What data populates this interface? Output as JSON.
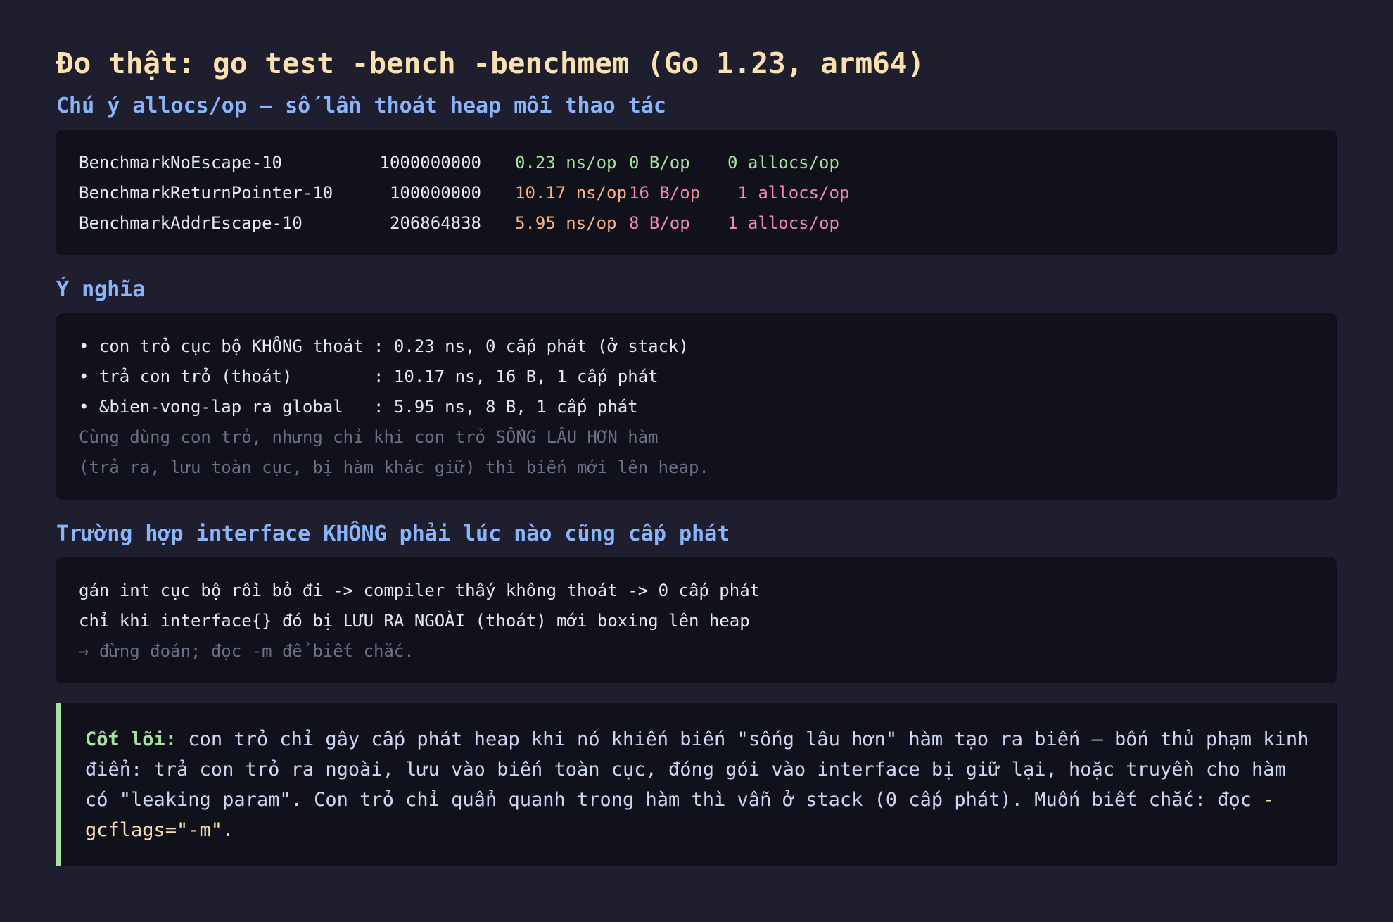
{
  "title": "Đo thật: go test -bench -benchmem (Go 1.23, arm64)",
  "section1": {
    "heading": "Chú ý allocs/op — số lần thoát heap mỗi thao tác",
    "rows": [
      {
        "name": "BenchmarkNoEscape-10",
        "iterations": "1000000000",
        "ns": "0.23 ns/op",
        "bytes": "0 B/op",
        "allocs": "0 allocs/op"
      },
      {
        "name": "BenchmarkReturnPointer-10",
        "iterations": "100000000",
        "ns": "10.17 ns/op",
        "bytes": "16 B/op",
        "allocs": " 1 allocs/op"
      },
      {
        "name": "BenchmarkAddrEscape-10",
        "iterations": "206864838",
        "ns": "5.95 ns/op",
        "bytes": "8 B/op",
        "allocs": "1 allocs/op"
      }
    ]
  },
  "section2": {
    "heading": "Ý nghĩa",
    "lines": [
      "• con trỏ cục bộ KHÔNG thoát : 0.23 ns, 0 cấp phát (ở stack)",
      "• trả con trỏ (thoát)        : 10.17 ns, 16 B, 1 cấp phát",
      "• &bien-vong-lap ra global   : 5.95 ns, 8 B, 1 cấp phát"
    ],
    "notes": [
      "Cùng dùng con trỏ, nhưng chỉ khi con trỏ SỐNG LÂU HƠN hàm",
      "(trả ra, lưu toàn cục, bị hàm khác giữ) thì biến mới lên heap."
    ]
  },
  "section3": {
    "heading": "Trường hợp interface KHÔNG phải lúc nào cũng cấp phát",
    "lines": [
      "gán int cục bộ rồi bỏ đi -> compiler thấy không thoát -> 0 cấp phát",
      "chỉ khi interface{} đó bị LƯU RA NGOÀI (thoát) mới boxing lên heap"
    ],
    "note": "→ đừng đoán; đọc -m để biết chắc."
  },
  "callout": {
    "lead": "Cốt lõi:",
    "text": " con trỏ chỉ gây cấp phát heap khi nó khiến biến \"sống lâu hơn\" hàm tạo ra biến — bốn thủ phạm kinh điển: trả con trỏ ra ngoài, lưu vào biến toàn cục, đóng gói vào interface bị giữ lại, hoặc truyền cho hàm có \"leaking param\". Con trỏ chỉ quẩn quanh trong hàm thì vẫn ở stack (0 cấp phát). Muốn biết chắc: đọc ",
    "code": "-gcflags=\"-m\"",
    "tail": "."
  },
  "colors": {
    "background": "#1e1e2e",
    "block": "#11111b",
    "title": "#f9e2af",
    "heading": "#89b4fa",
    "good": "#a6e3a1",
    "warn": "#fab387",
    "bad": "#f38ba8"
  }
}
